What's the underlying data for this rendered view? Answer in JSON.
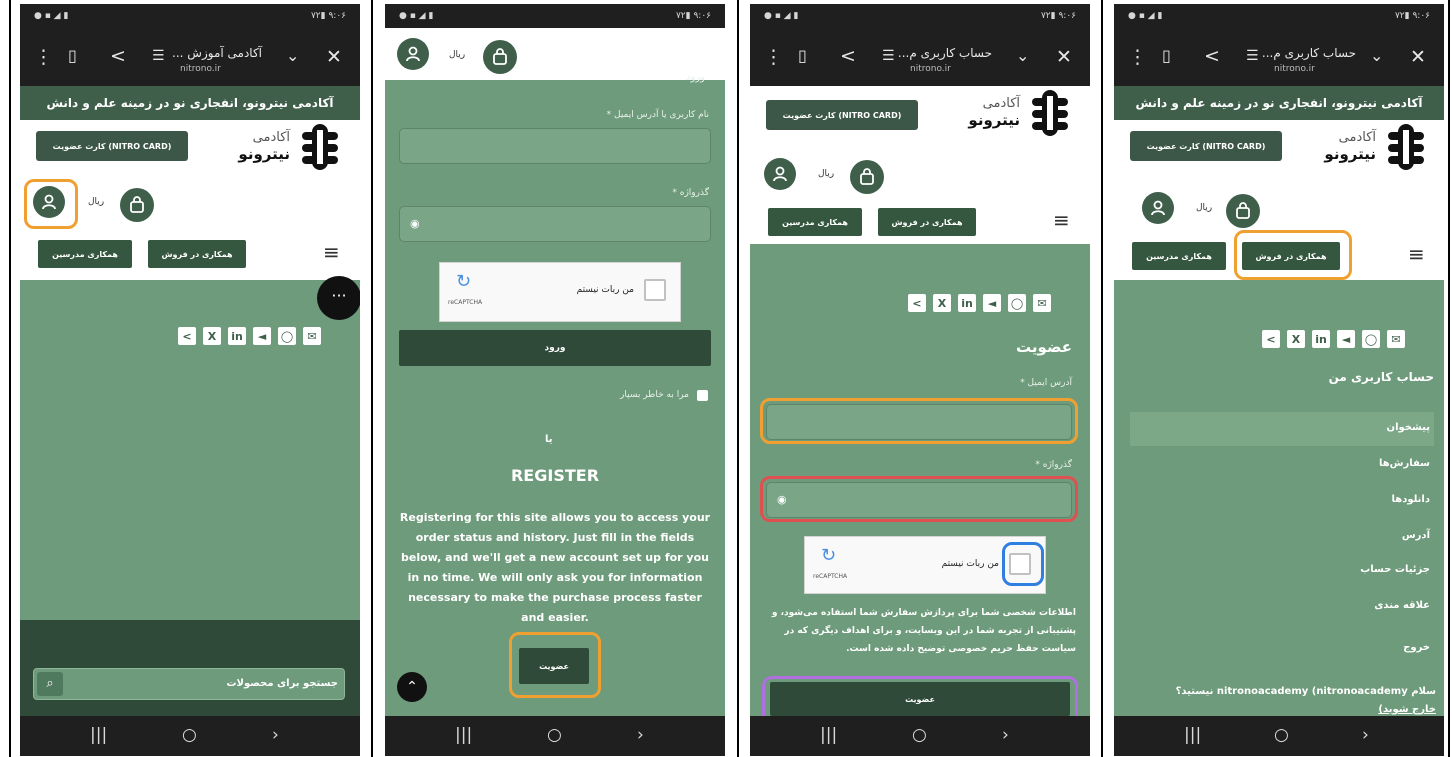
{
  "status_time": "۹:۰۶",
  "status_battery": "۷۲",
  "panels": [
    {
      "tab_title": "آکادمی آموزش ...",
      "url": "nitrono.ir",
      "banner": "آکادمی نیترونو، انفجاری نو در زمینه علم و دانش",
      "card_button": "کارت عضویت (NITRO CARD)",
      "logo_small": "آکادمی",
      "logo_big": "نیترونو",
      "currency": "ریال",
      "nav_buttons": [
        "همکاری در فروش",
        "همکاری مدرسین"
      ],
      "search_placeholder": "جستجو برای محصولات"
    },
    {
      "currency": "ریال",
      "login_heading": "ورود",
      "username_label": "نام کاربری یا آدرس ایمیل *",
      "password_label": "گذرواژه *",
      "captcha_text": "من ربات نیستم",
      "captcha_brand": "reCAPTCHA",
      "login_button": "ورود",
      "remember_label": "مرا به خاطر بسپار",
      "or_text": "یا",
      "register_title": "REGISTER",
      "register_description": "Registering for this site allows you to access your order status and history. Just fill in the fields below, and we'll get a new account set up for you in no time. We will only ask you for information necessary to make the purchase process faster and easier.",
      "register_button": "عضویت"
    },
    {
      "tab_title": "حساب کاربری م...",
      "url": "nitrono.ir",
      "card_button": "کارت عضویت (NITRO CARD)",
      "logo_small": "آکادمی",
      "logo_big": "نیترونو",
      "currency": "ریال",
      "nav_buttons": [
        "همکاری در فروش",
        "همکاری مدرسین"
      ],
      "signup_heading": "عضویت",
      "email_label": "آدرس ایمیل *",
      "password_label": "گذرواژه *",
      "captcha_text": "من ربات نیستم",
      "captcha_brand": "reCAPTCHA",
      "privacy_text": "اطلاعات شخصی شما برای پردازش سفارش شما استفاده می‌شود، و پشتیبانی از تجربه شما در این وبسایت، و برای اهداف دیگری که در سیاست حفظ حریم خصوصی توضیح داده شده است.",
      "signup_button": "عضویت"
    },
    {
      "tab_title": "حساب کاربری م...",
      "url": "nitrono.ir",
      "banner": "آکادمی نیترونو، انفجاری نو در زمینه علم و دانش",
      "card_button": "کارت عضویت (NITRO CARD)",
      "logo_small": "آکادمی",
      "logo_big": "نیترونو",
      "currency": "ریال",
      "nav_buttons": [
        "همکاری در فروش",
        "همکاری مدرسین"
      ],
      "account_heading": "حساب کاربری من",
      "menu": [
        "پیشخوان",
        "سفارش‌ها",
        "دانلودها",
        "آدرس",
        "جزئیات حساب",
        "علاقه مندی",
        "خروج"
      ],
      "greeting": "سلام nitronoacademy (nitronoacademy نیستید؟",
      "logout_link": "خارج شوید)"
    }
  ],
  "colors": {
    "brand_green": "#3f5f4b",
    "page_green": "#6e9b7b",
    "highlight_orange": "#f0a030",
    "highlight_red": "#e05050",
    "highlight_blue": "#2f7fe0",
    "highlight_purple": "#b070e0"
  }
}
